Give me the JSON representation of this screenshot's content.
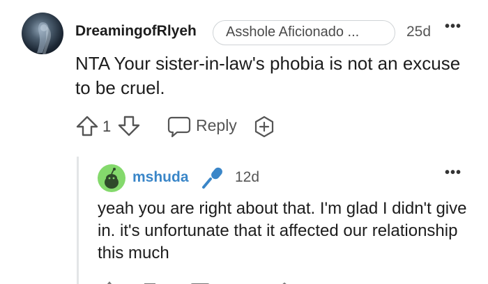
{
  "parent_comment": {
    "username": "DreamingofRlyeh",
    "flair": "Asshole Aficionado ...",
    "timestamp": "25d",
    "more_label": "•••",
    "body": "NTA Your sister-in-law's phobia is not an excuse to be cruel.",
    "vote_count": "1",
    "reply_label": "Reply",
    "icons": {
      "upvote": "arrow-up-icon",
      "downvote": "arrow-down-icon",
      "reply": "chat-bubble-icon",
      "award": "add-award-icon"
    }
  },
  "reply_comment": {
    "username": "mshuda",
    "username_color": "#3a86c8",
    "badge_icon": "microphone-icon",
    "timestamp": "12d",
    "more_label": "•••",
    "body": "yeah you are right about that. I'm glad I didn't give in. it's unfortunate that it affected our relationship this much"
  },
  "colors": {
    "avatar_reply": "#84d96c",
    "mic_icon": "#3a86c8",
    "thread_line": "#e3e5e7"
  }
}
